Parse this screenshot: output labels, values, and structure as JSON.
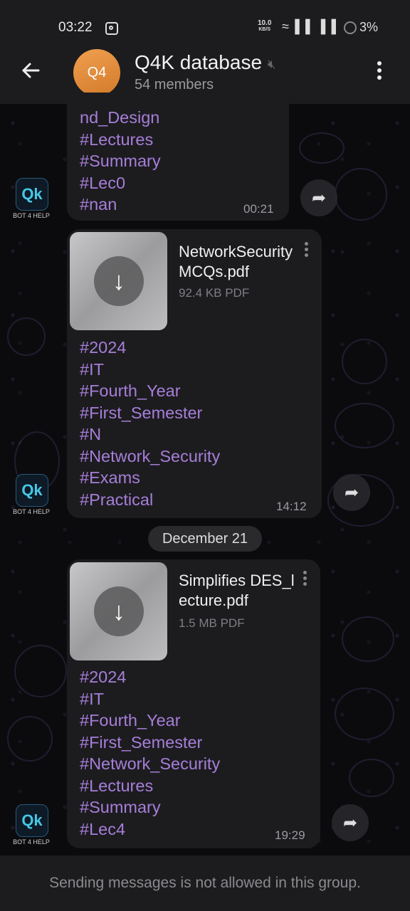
{
  "status_bar": {
    "time": "03:22",
    "net_speed_value": "10.0",
    "net_speed_unit": "KB/S",
    "battery": "3%"
  },
  "header": {
    "avatar_text": "Q4",
    "title": "Q4K database",
    "subtitle": "54 members"
  },
  "bot": {
    "caption": "BOT 4 HELP",
    "logo": "Qk"
  },
  "messages": [
    {
      "tags": [
        "nd_Design",
        "#Lectures",
        "#Summary",
        "#Lec0",
        "#nan"
      ],
      "time": "00:21"
    },
    {
      "file_name": "NetworkSecurityMCQs.pdf",
      "file_size": "92.4 KB PDF",
      "tags": [
        "#2024",
        "#IT",
        "#Fourth_Year",
        "#First_Semester",
        "#N",
        "#Network_Security",
        "#Exams",
        "#Practical"
      ],
      "time": "14:12"
    },
    {
      "file_name": "Simplifies DES_lecture.pdf",
      "file_size": "1.5 MB PDF",
      "tags": [
        "#2024",
        "#IT",
        "#Fourth_Year",
        "#First_Semester",
        "#Network_Security",
        "#Lectures",
        "#Summary",
        "#Lec4"
      ],
      "time": "19:29"
    }
  ],
  "date_separator": "December 21",
  "footer": {
    "notice": "Sending messages is not allowed in this group."
  }
}
